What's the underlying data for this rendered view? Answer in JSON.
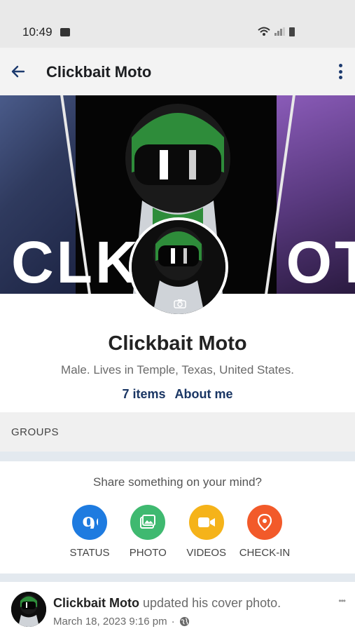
{
  "status_bar": {
    "time": "10:49"
  },
  "app_bar": {
    "title": "Clickbait Moto"
  },
  "cover": {
    "text": "CLKBMOTO"
  },
  "profile": {
    "name": "Clickbait Moto",
    "bio": "Male. Lives in Temple, Texas, United States.",
    "items_link": "7 items",
    "about_link": "About me"
  },
  "groups": {
    "label": "GROUPS"
  },
  "share": {
    "title": "Share something on your mind?",
    "actions": [
      {
        "label": "STATUS",
        "color": "#1e7be0",
        "icon": "quote-icon"
      },
      {
        "label": "PHOTO",
        "color": "#3fb970",
        "icon": "photo-icon"
      },
      {
        "label": "VIDEOS",
        "color": "#f5b31a",
        "icon": "video-camera-icon"
      },
      {
        "label": "CHECK-IN",
        "color": "#f25a2a",
        "icon": "location-pin-icon"
      }
    ]
  },
  "post": {
    "author": "Clickbait Moto",
    "action_text": " updated his cover photo.",
    "timestamp": "March 18, 2023 9:16 pm",
    "separator": "·"
  }
}
